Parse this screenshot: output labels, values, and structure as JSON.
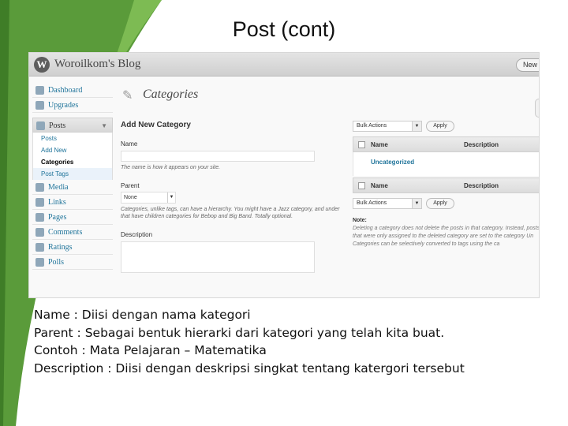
{
  "slide": {
    "title": "Post (cont)"
  },
  "colors": {
    "deco_green": "#5a9b3a",
    "link_blue": "#21759b"
  },
  "wp": {
    "blog_name": "Woroilkom's Blog",
    "new_button": "New P",
    "menu": [
      {
        "label": "Dashboard",
        "icon": "dashboard-icon"
      },
      {
        "label": "Upgrades",
        "icon": "upgrades-icon"
      }
    ],
    "posts_section": {
      "label": "Posts",
      "icon": "posts-pin-icon",
      "items": [
        "Posts",
        "Add New",
        "Categories",
        "Post Tags"
      ]
    },
    "menu_after": [
      {
        "label": "Media",
        "icon": "media-icon"
      },
      {
        "label": "Links",
        "icon": "links-icon"
      },
      {
        "label": "Pages",
        "icon": "pages-icon"
      },
      {
        "label": "Comments",
        "icon": "comments-icon"
      },
      {
        "label": "Ratings",
        "icon": "ratings-icon"
      },
      {
        "label": "Polls",
        "icon": "polls-icon"
      }
    ],
    "page_title": "Categories",
    "form": {
      "heading": "Add New Category",
      "name_label": "Name",
      "name_hint": "The name is how it appears on your site.",
      "parent_label": "Parent",
      "parent_value": "None",
      "parent_hint": "Categories, unlike tags, can have a hierarchy. You might have a Jazz category, and under that have children categories for Bebop and Big Band. Totally optional.",
      "description_label": "Description"
    },
    "list": {
      "bulk_actions": "Bulk Actions",
      "apply": "Apply",
      "col_name": "Name",
      "col_description": "Description",
      "rows": [
        "Uncategorized"
      ],
      "note_title": "Note:",
      "note_text": "Deleting a category does not delete the posts in that category. Instead, posts that were only assigned to the deleted category are set to the category Un",
      "note_text2": "Categories can be selectively converted to tags using the ca"
    }
  },
  "notes": [
    "Name  : Diisi dengan nama kategori",
    "Parent  : Sebagai bentuk hierarki dari kategori yang telah kita buat.",
    "Contoh : Mata Pelajaran – Matematika",
    "Description : Diisi dengan deskripsi singkat tentang katergori tersebut"
  ]
}
